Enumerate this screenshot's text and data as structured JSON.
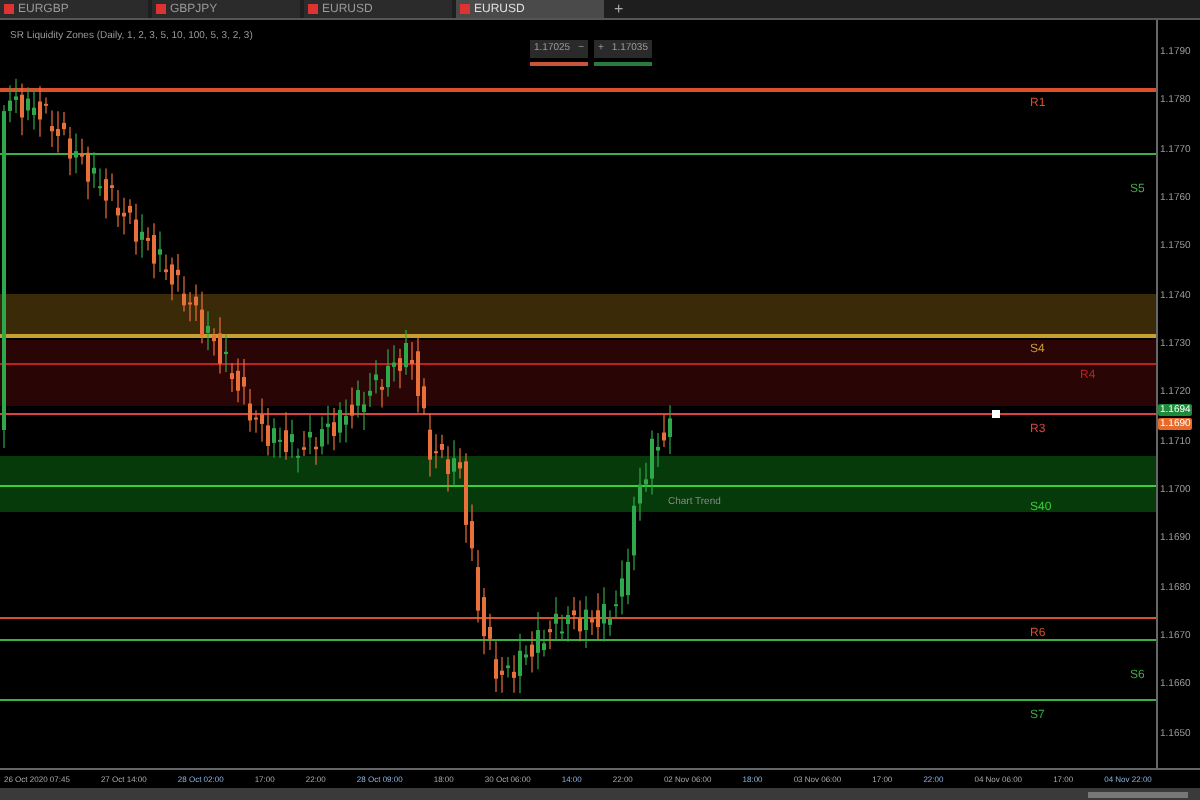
{
  "tabs": [
    {
      "label": "EURGBP",
      "selected": false
    },
    {
      "label": "GBPJPY",
      "selected": false
    },
    {
      "label": "EURUSD",
      "selected": false
    },
    {
      "label": "EURUSD",
      "selected": true
    }
  ],
  "new_tab": "+",
  "indicator_title": "SR Liquidity Zones (Daily, 1, 2, 3, 5, 10, 100, 5, 3, 2, 3)",
  "quote": {
    "bid": "1.17025",
    "sell": "−",
    "buy": "+",
    "ask": "1.17035"
  },
  "levels": [
    {
      "label": "R1",
      "color": "#d9502a"
    },
    {
      "label": "S5",
      "color": "#3cb043"
    },
    {
      "label": "S4",
      "color": "#c8a030"
    },
    {
      "label": "R4",
      "color": "#c02020"
    },
    {
      "label": "R3",
      "color": "#e04040"
    },
    {
      "label": "S40",
      "color": "#3ad03a"
    },
    {
      "label": "R6",
      "color": "#d9502a"
    },
    {
      "label": "S6",
      "color": "#3cb043"
    },
    {
      "label": "S7",
      "color": "#3cb043"
    }
  ],
  "cursor_label": "Chart Trend",
  "price_axis": [
    "1.1790",
    "1.1780",
    "1.1770",
    "1.1760",
    "1.1750",
    "1.1740",
    "1.1730",
    "1.1720",
    "1.1710",
    "1.1700",
    "1.1690",
    "1.1680",
    "1.1670",
    "1.1660",
    "1.1650"
  ],
  "price_tags": [
    {
      "text": "1.1694",
      "color": "#1f8a3a"
    },
    {
      "text": "1.1690",
      "color": "#e86a2a"
    }
  ],
  "time_axis": [
    "26 Oct 2020 07:45",
    "27 Oct 14:00",
    "28 Oct 02:00",
    "17:00",
    "22:00",
    "28 Oct 09:00",
    "18:00",
    "30 Oct 06:00",
    "14:00",
    "22:00",
    "02 Nov 06:00",
    "18:00",
    "03 Nov 06:00",
    "17:00",
    "22:00",
    "04 Nov 06:00",
    "17:00",
    "04 Nov 22:00"
  ]
}
